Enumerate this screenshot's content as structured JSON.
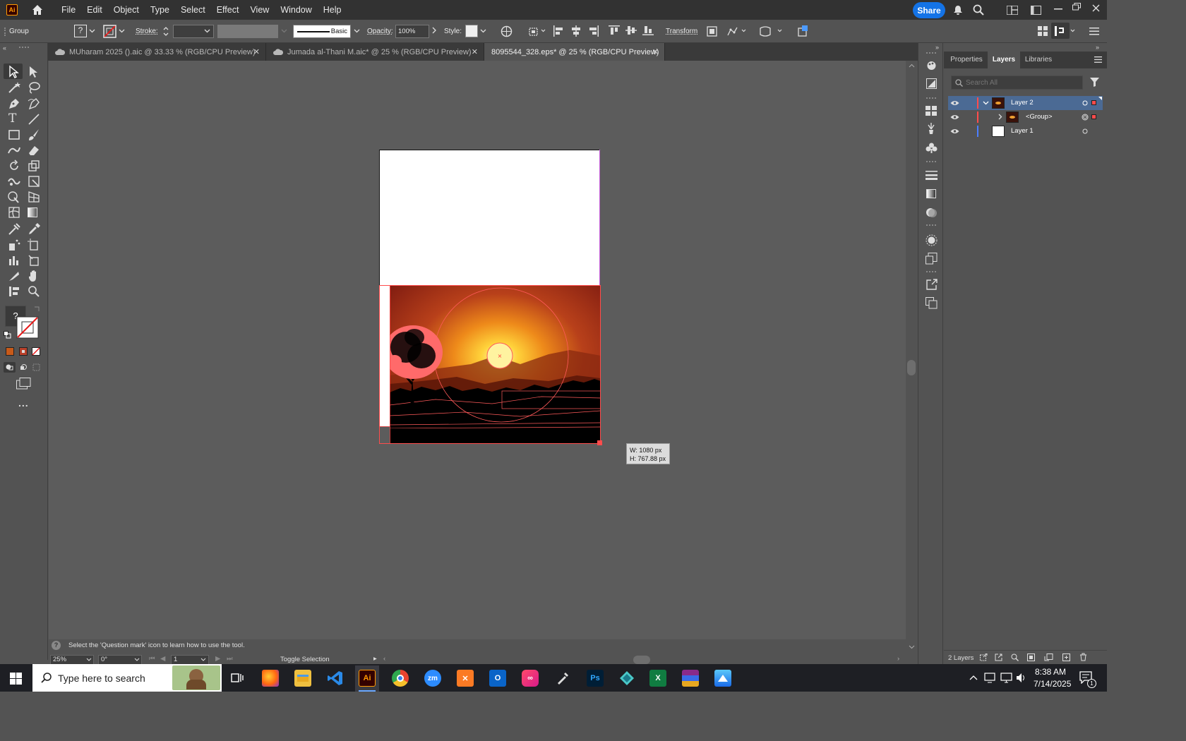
{
  "menubar": {
    "app_icon": "Ai",
    "items": [
      "File",
      "Edit",
      "Object",
      "Type",
      "Select",
      "Effect",
      "View",
      "Window",
      "Help"
    ],
    "share": "Share"
  },
  "controlbar": {
    "selection_type": "Group",
    "fill_swatch": "?",
    "stroke_label": "Stroke:",
    "stroke_profile": "Basic",
    "opacity_label": "Opacity:",
    "opacity_value": "100%",
    "style_label": "Style:",
    "transform_label": "Transform"
  },
  "tabs": [
    {
      "label": "MUharam 2025 ().aic @ 33.33 % (RGB/CPU Preview)",
      "active": false
    },
    {
      "label": "Jumada al-Thani M.aic* @ 25 % (RGB/CPU Preview)",
      "active": false
    },
    {
      "label": "8095544_328.eps* @ 25 % (RGB/CPU Preview)",
      "active": true
    }
  ],
  "toolbar": {
    "fill_stroke_help": "?",
    "more_tools": "..."
  },
  "canvas": {
    "size_tooltip_w": "W: 1080 px",
    "size_tooltip_h": "H: 767.88 px"
  },
  "panel": {
    "tabs": [
      "Properties",
      "Layers",
      "Libraries"
    ],
    "active_tab": "Layers",
    "search_placeholder": "Search All",
    "layers": [
      {
        "name": "Layer 2",
        "expanded": true,
        "color": "#ff4c4c",
        "selected": true
      },
      {
        "name": "<Group>",
        "expanded": false,
        "color": "#ff4c4c",
        "selected": false
      },
      {
        "name": "Layer 1",
        "expanded": false,
        "color": "#4c7fff",
        "selected": false
      }
    ],
    "footer_count": "2 Layers"
  },
  "statusbar": {
    "hint": "Select the 'Question mark' icon to learn how to use the tool.",
    "zoom": "25%",
    "rotation": "0°",
    "artboard": "1",
    "mode": "Toggle Selection"
  },
  "taskbar": {
    "search_placeholder": "Type here to search",
    "time": "8:38 AM",
    "date": "7/14/2025",
    "notifications": "1",
    "apps": [
      "task-view",
      "firefox",
      "file-explorer",
      "vscode",
      "illustrator",
      "chrome",
      "zoom",
      "xampp",
      "outlook",
      "creative-cloud",
      "inkscape-pen",
      "photoshop",
      "app-diamond",
      "excel",
      "winrar",
      "photos"
    ]
  }
}
